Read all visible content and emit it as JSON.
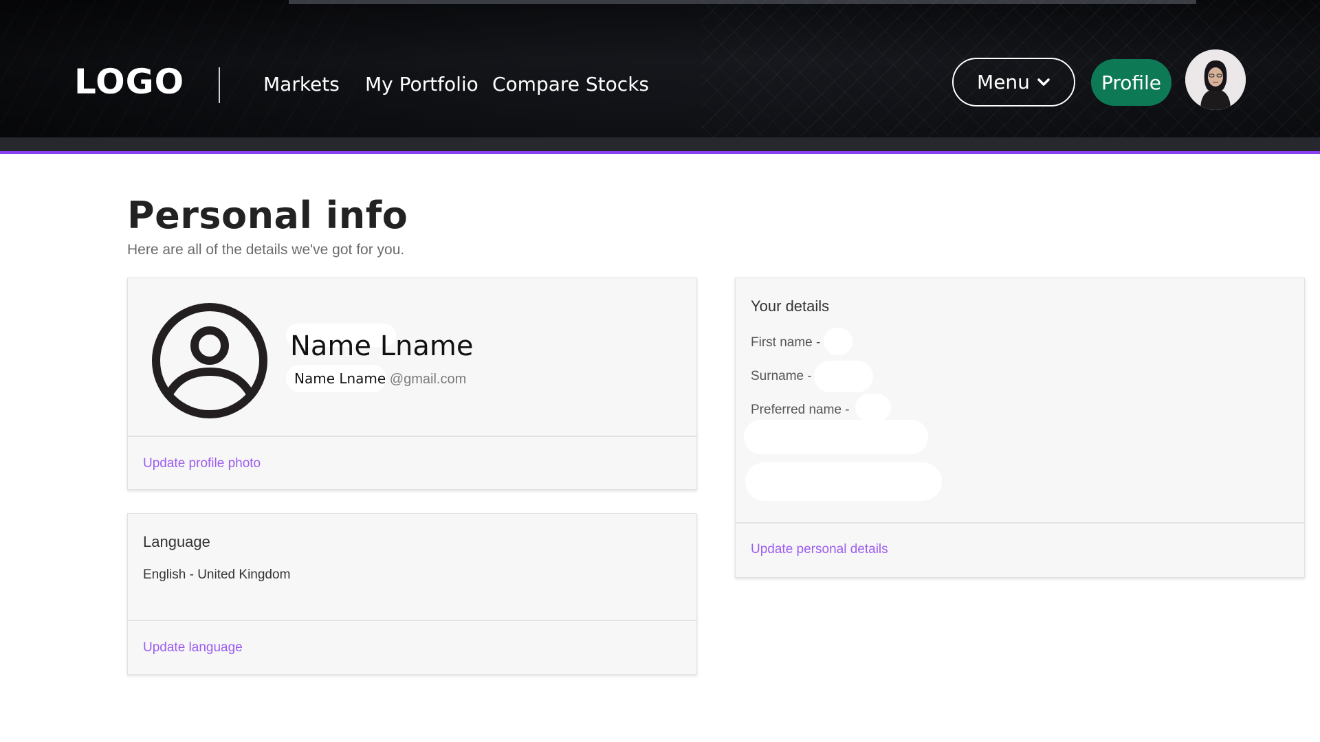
{
  "header": {
    "logo": "LOGO",
    "nav": {
      "markets": "Markets",
      "portfolio": "My Portfolio",
      "compare": "Compare Stocks"
    },
    "menu_label": "Menu",
    "profile_label": "Profile",
    "accent_color": "#8a3ff0",
    "profile_color": "#0e7a55"
  },
  "page": {
    "title": "Personal info",
    "subtitle": "Here are all of the details we've got for you."
  },
  "profile_card": {
    "name": "Name Lname",
    "email_user": "Name Lname",
    "email_domain": "@gmail.com",
    "update_photo": "Update profile photo"
  },
  "language_card": {
    "heading": "Language",
    "value": "English - United Kingdom",
    "update_link": "Update language"
  },
  "details_card": {
    "heading": "Your details",
    "first_name_label": "First name -",
    "surname_label": "Surname -",
    "preferred_name_label": "Preferred name -",
    "update_link": "Update personal details"
  },
  "link_color": "#9b5cf0"
}
